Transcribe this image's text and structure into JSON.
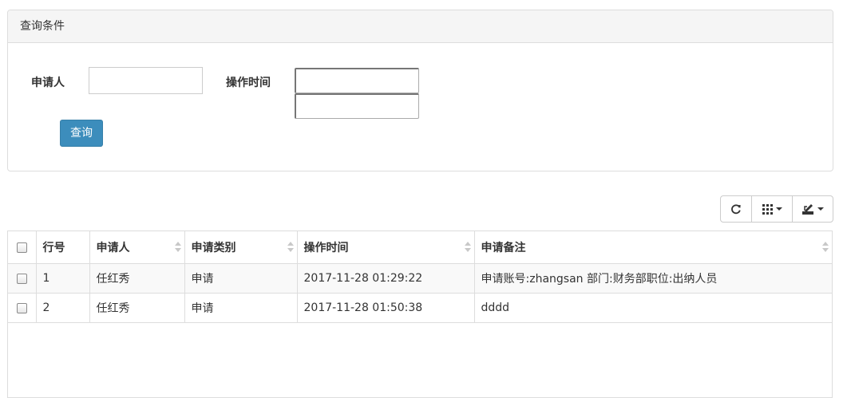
{
  "search_panel": {
    "title": "查询条件",
    "applicant_label": "申请人",
    "applicant_value": "",
    "op_time_label": "操作时间",
    "date_start_value": "",
    "date_end_value": "",
    "query_button": "查询"
  },
  "toolbar": {
    "refresh_icon": "refresh-icon",
    "columns_icon": "grid-icon",
    "export_icon": "export-icon"
  },
  "table": {
    "headers": [
      "行号",
      "申请人",
      "申请类别",
      "操作时间",
      "申请备注"
    ],
    "rows": [
      {
        "no": "1",
        "applicant": "任红秀",
        "category": "申请",
        "time": "2017-11-28 01:29:22",
        "remark": "申请账号:zhangsan 部门:财务部职位:出纳人员"
      },
      {
        "no": "2",
        "applicant": "任红秀",
        "category": "申请",
        "time": "2017-11-28 01:50:38",
        "remark": "dddd"
      }
    ]
  }
}
